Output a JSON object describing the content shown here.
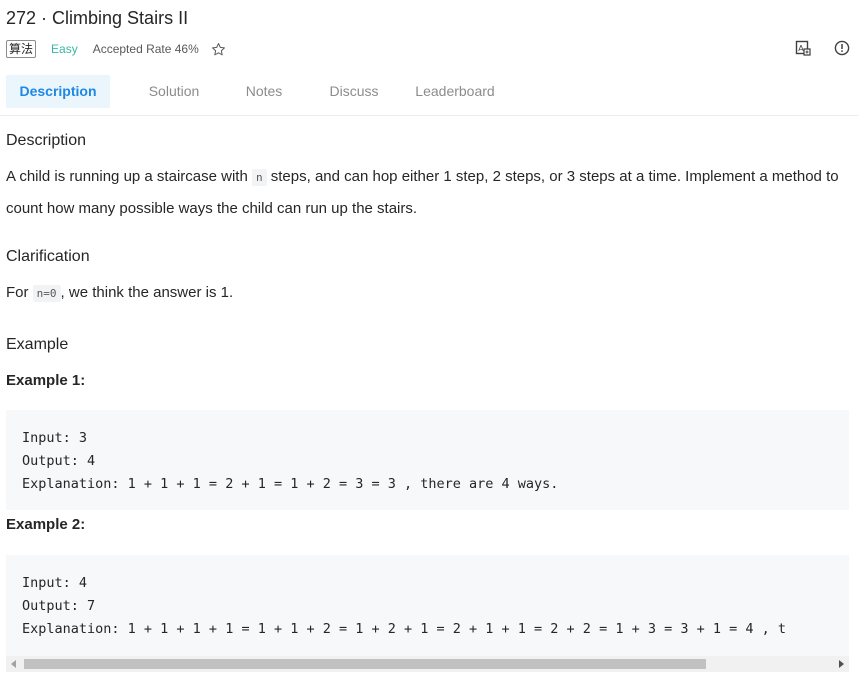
{
  "problem": {
    "title": "272 · Climbing Stairs II",
    "tag": "算法",
    "difficulty": "Easy",
    "accepted_rate": "Accepted Rate 46%"
  },
  "icons": {
    "favorite": "star-icon",
    "translate": "translate-icon",
    "report": "info-icon"
  },
  "tabs": [
    {
      "label": "Description",
      "active": true
    },
    {
      "label": "Solution",
      "active": false
    },
    {
      "label": "Notes",
      "active": false
    },
    {
      "label": "Discuss",
      "active": false
    },
    {
      "label": "Leaderboard",
      "active": false
    }
  ],
  "content": {
    "description_heading": "Description",
    "description_part1": "A child is running up a staircase with ",
    "description_code": "n",
    "description_part2": " steps, and can hop either 1 step, 2 steps, or 3 steps at a time. Implement a method to count how many possible ways the child can run up the stairs.",
    "clarification_heading": "Clarification",
    "clarification_part1": "For ",
    "clarification_code": "n=0",
    "clarification_part2": ", we think the answer is 1.",
    "example_heading": "Example",
    "example1_heading": "Example 1:",
    "example1_input": "Input: 3",
    "example1_output": "Output: 4",
    "example1_explanation": "Explanation: 1 + 1 + 1 = 2 + 1 = 1 + 2 = 3 = 3 , there are 4 ways.",
    "example2_heading": "Example 2:",
    "example2_input": "Input: 4",
    "example2_output": "Output: 7",
    "example2_explanation": "Explanation: 1 + 1 + 1 + 1 = 1 + 1 + 2 = 1 + 2 + 1 = 2 + 1 + 1 = 2 + 2 = 1 + 3 = 3 + 1 = 4 , t"
  },
  "colors": {
    "accent": "#1e88e5",
    "easy": "#3ab6a4",
    "tab_active_bg": "#eaf5fc"
  }
}
